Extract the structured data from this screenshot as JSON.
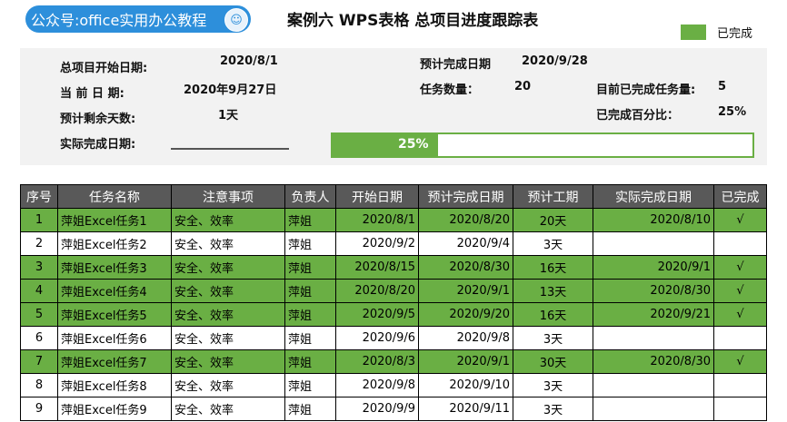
{
  "banner": {
    "text": "公众号:office实用办公教程"
  },
  "title": "案例六 WPS表格 总项目进度跟踪表",
  "legend": {
    "label": "已完成",
    "color": "#6aaf44"
  },
  "summary": {
    "start_label": "总项目开始日期:",
    "start_value": "2020/8/1",
    "planned_label": "预计完成日期",
    "planned_value": "2020/9/28",
    "today_label": "当 前 日 期:",
    "today_value": "2020年9月27日",
    "task_count_label": "任务数量：",
    "task_count_value": "20",
    "done_count_label": "目前已完成任务量:",
    "done_count_value": "5",
    "remaining_label": "预计剩余天数:",
    "remaining_value": "1天",
    "percent_label": "已完成百分比：",
    "percent_value": "25%",
    "actual_label": "实际完成日期:",
    "progress_text": "25%",
    "progress_fraction": 0.25
  },
  "table": {
    "headers": [
      "序号",
      "任务名称",
      "注意事项",
      "负责人",
      "开始日期",
      "预计完成日期",
      "预计工期",
      "实际完成日期",
      "已完成"
    ],
    "rows": [
      {
        "no": "1",
        "name": "萍姐Excel任务1",
        "note": "安全、效率",
        "owner": "萍姐",
        "start": "2020/8/1",
        "plan": "2020/8/20",
        "dur": "20天",
        "actual": "2020/8/10",
        "done": "√",
        "completed": true
      },
      {
        "no": "2",
        "name": "萍姐Excel任务2",
        "note": "安全、效率",
        "owner": "萍姐",
        "start": "2020/9/2",
        "plan": "2020/9/4",
        "dur": "3天",
        "actual": "",
        "done": "",
        "completed": false
      },
      {
        "no": "3",
        "name": "萍姐Excel任务3",
        "note": "安全、效率",
        "owner": "萍姐",
        "start": "2020/8/15",
        "plan": "2020/8/30",
        "dur": "16天",
        "actual": "2020/9/1",
        "done": "√",
        "completed": true
      },
      {
        "no": "4",
        "name": "萍姐Excel任务4",
        "note": "安全、效率",
        "owner": "萍姐",
        "start": "2020/8/20",
        "plan": "2020/9/1",
        "dur": "13天",
        "actual": "2020/8/30",
        "done": "√",
        "completed": true
      },
      {
        "no": "5",
        "name": "萍姐Excel任务5",
        "note": "安全、效率",
        "owner": "萍姐",
        "start": "2020/9/5",
        "plan": "2020/9/20",
        "dur": "16天",
        "actual": "2020/9/21",
        "done": "√",
        "completed": true
      },
      {
        "no": "6",
        "name": "萍姐Excel任务6",
        "note": "安全、效率",
        "owner": "萍姐",
        "start": "2020/9/6",
        "plan": "2020/9/8",
        "dur": "3天",
        "actual": "",
        "done": "",
        "completed": false
      },
      {
        "no": "7",
        "name": "萍姐Excel任务7",
        "note": "安全、效率",
        "owner": "萍姐",
        "start": "2020/8/3",
        "plan": "2020/9/1",
        "dur": "30天",
        "actual": "2020/8/30",
        "done": "√",
        "completed": true
      },
      {
        "no": "8",
        "name": "萍姐Excel任务8",
        "note": "安全、效率",
        "owner": "萍姐",
        "start": "2020/9/8",
        "plan": "2020/9/10",
        "dur": "3天",
        "actual": "",
        "done": "",
        "completed": false
      },
      {
        "no": "9",
        "name": "萍姐Excel任务9",
        "note": "安全、效率",
        "owner": "萍姐",
        "start": "2020/9/9",
        "plan": "2020/9/11",
        "dur": "3天",
        "actual": "",
        "done": "",
        "completed": false
      }
    ]
  }
}
